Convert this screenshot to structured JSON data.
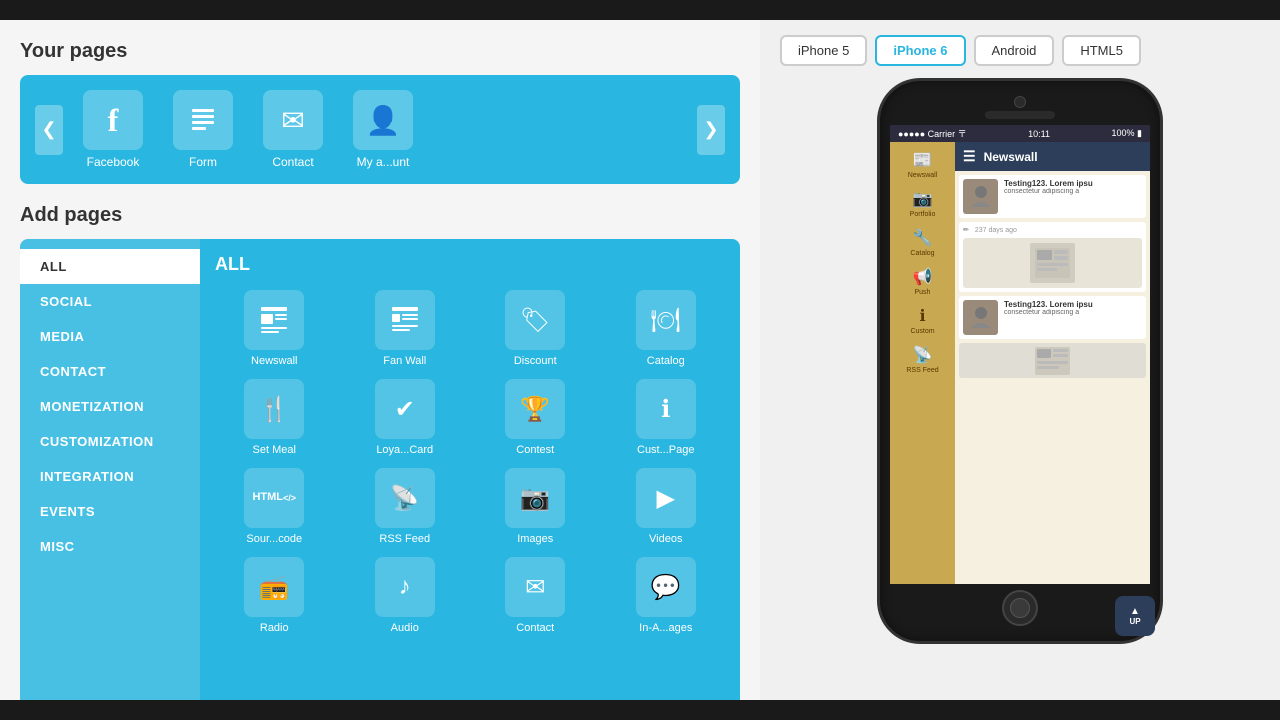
{
  "left": {
    "your_pages_title": "Your pages",
    "add_pages_title": "Add pages",
    "prev_btn": "❮",
    "next_btn": "❯",
    "pages": [
      {
        "icon": "f",
        "label": "Facebook",
        "icon_type": "facebook"
      },
      {
        "icon": "📋",
        "label": "Form",
        "icon_type": "form"
      },
      {
        "icon": "✉",
        "label": "Contact",
        "icon_type": "contact"
      },
      {
        "icon": "👤",
        "label": "My a...unt",
        "icon_type": "account"
      }
    ],
    "categories": [
      {
        "id": "all",
        "label": "ALL",
        "active": true
      },
      {
        "id": "social",
        "label": "SOCIAL",
        "active": false
      },
      {
        "id": "media",
        "label": "MEDIA",
        "active": false
      },
      {
        "id": "contact",
        "label": "CONTACT",
        "active": false
      },
      {
        "id": "monetization",
        "label": "MONETIZATION",
        "active": false
      },
      {
        "id": "customization",
        "label": "CUSTOMIZATION",
        "active": false
      },
      {
        "id": "integration",
        "label": "INTEGRATION",
        "active": false
      },
      {
        "id": "events",
        "label": "EVENTS",
        "active": false
      },
      {
        "id": "misc",
        "label": "MISC",
        "active": false
      }
    ],
    "items_section_label": "ALL",
    "grid_items": [
      {
        "icon": "📰",
        "label": "Newswall"
      },
      {
        "icon": "📰",
        "label": "Fan Wall",
        "icon_alt": "wall"
      },
      {
        "icon": "🏷",
        "label": "Discount"
      },
      {
        "icon": "🍽",
        "label": "Catalog"
      },
      {
        "icon": "🍴",
        "label": "Set Meal"
      },
      {
        "icon": "✔",
        "label": "Loya...Card"
      },
      {
        "icon": "🏆",
        "label": "Contest"
      },
      {
        "icon": "ℹ",
        "label": "Cust...Page"
      },
      {
        "icon": "HTML",
        "label": "Sour...code",
        "icon_type": "html"
      },
      {
        "icon": "📡",
        "label": "RSS Feed"
      },
      {
        "icon": "📷",
        "label": "Images"
      },
      {
        "icon": "▶",
        "label": "Videos"
      },
      {
        "icon": "📻",
        "label": "Radio"
      },
      {
        "icon": "♪",
        "label": "Audio"
      },
      {
        "icon": "✉",
        "label": "Contact"
      },
      {
        "icon": "💬",
        "label": "In-A...ages"
      }
    ]
  },
  "right": {
    "device_buttons": [
      {
        "label": "iPhone 5",
        "active": false
      },
      {
        "label": "iPhone 6",
        "active": true
      },
      {
        "label": "Android",
        "active": false
      },
      {
        "label": "HTML5",
        "active": false
      }
    ],
    "phone": {
      "status_bar": {
        "signal": "●●●●● Carrier",
        "wifi": "WiFi",
        "time": "10:11",
        "battery": "100%"
      },
      "sidebar_items": [
        {
          "icon": "📰",
          "label": "Newswall"
        },
        {
          "icon": "📷",
          "label": "Portfolio"
        },
        {
          "icon": "🔧",
          "label": "Catalog"
        },
        {
          "icon": "📢",
          "label": "Push"
        },
        {
          "icon": "ℹ",
          "label": "Custom"
        },
        {
          "icon": "📡",
          "label": "RSS Feed"
        }
      ],
      "header_title": "Newswall",
      "news_items": [
        {
          "title": "Testing123. Lorem ipsu",
          "desc": "consectetur adipiscing a",
          "has_thumb": true
        },
        {
          "date": "237 days ago",
          "has_image_card": true
        },
        {
          "title": "Testing123. Lorem ipsu",
          "desc": "consectetur adipiscing a",
          "has_thumb": true
        }
      ]
    }
  }
}
